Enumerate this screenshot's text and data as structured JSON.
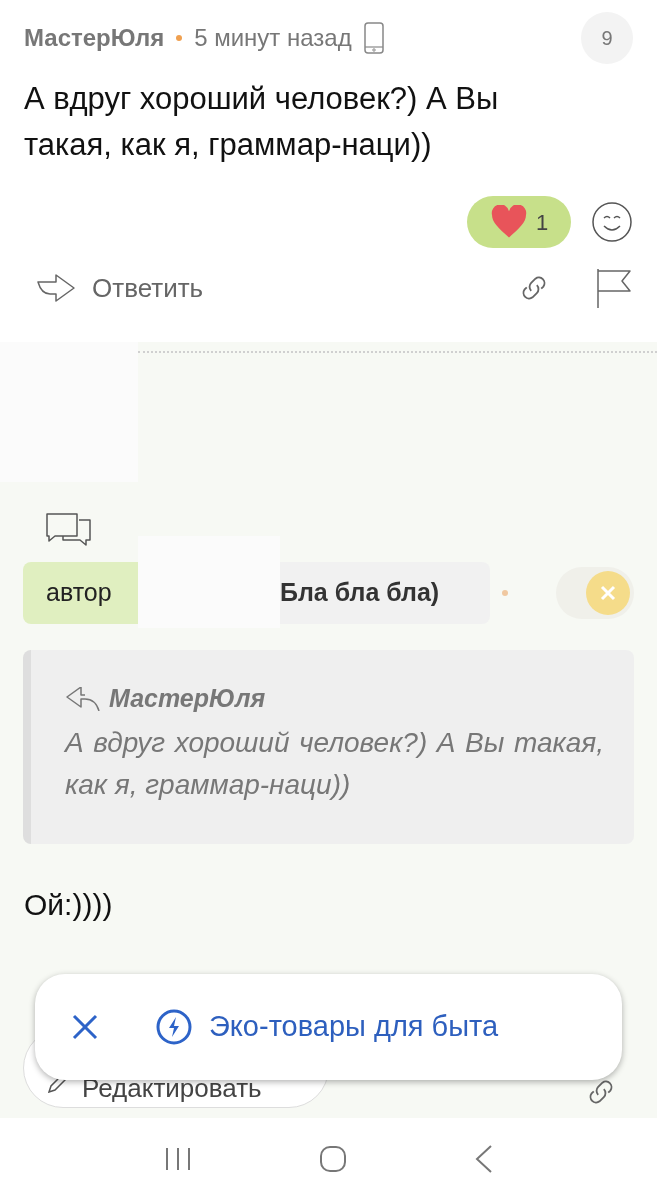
{
  "comment": {
    "author": "МастерЮля",
    "time": "5 минут назад",
    "counter": "9",
    "text": "А вдруг хороший человек?) А Вы такая, как я, граммар-наци))",
    "reaction": {
      "count": "1",
      "selected": true
    },
    "reply": "Ответить"
  },
  "draft": {
    "tag": "автор",
    "title": "Бла бла бла)",
    "quote": {
      "author": "МастерЮля",
      "text": "А вдруг хороший человек?) А Вы такая, как я, граммар-наци))"
    },
    "text": "Ой:))))",
    "edit": "Редактировать"
  },
  "popup": {
    "label": "Эко-товары для быта"
  }
}
